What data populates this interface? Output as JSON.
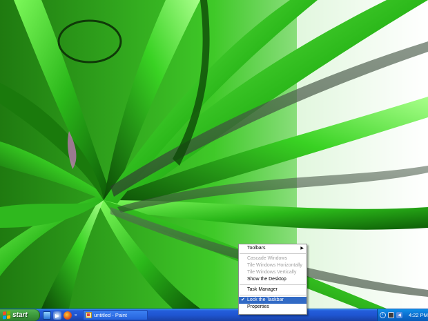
{
  "desktop": {
    "wallpaper": "green-grass-3d-abstract"
  },
  "taskbar": {
    "start_label": "start",
    "quick_launch": [
      {
        "icon": "show-desktop-icon"
      },
      {
        "icon": "windows-media-player-icon"
      },
      {
        "icon": "firefox-icon"
      }
    ],
    "task_button": {
      "label": "untitled - Paint",
      "icon": "paint-icon"
    },
    "tray": {
      "clock": "4:22 PM"
    }
  },
  "context_menu": {
    "items": [
      {
        "label": "Toolbars",
        "submenu": true
      },
      {
        "label": "Cascade Windows",
        "disabled": true
      },
      {
        "label": "Tile Windows Horizontally",
        "disabled": true
      },
      {
        "label": "Tile Windows Vertically",
        "disabled": true
      },
      {
        "label": "Show the Desktop"
      },
      {
        "label": "Task Manager"
      },
      {
        "label": "Lock the Taskbar",
        "checked": true,
        "selected": true
      },
      {
        "label": "Properties"
      }
    ]
  },
  "colors": {
    "taskbar_blue": "#245edb",
    "start_green": "#3c9a3c",
    "menu_highlight": "#316ac5"
  }
}
